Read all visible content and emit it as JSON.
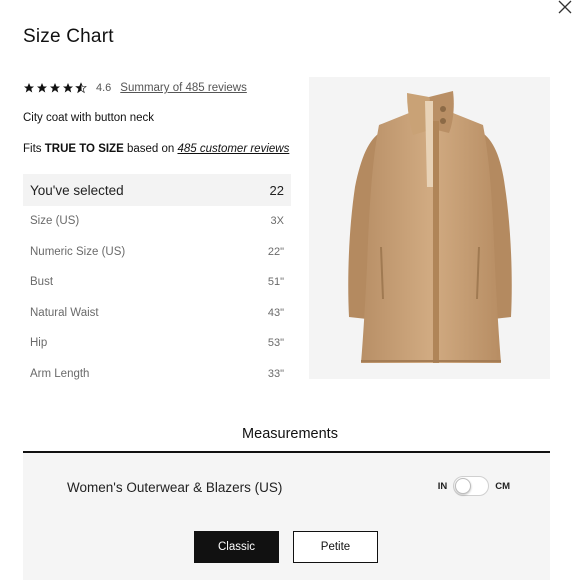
{
  "dialog": {
    "title": "Size Chart",
    "close_icon": "close-icon"
  },
  "rating": {
    "stars": 4.5,
    "value": "4.6",
    "summary_link": "Summary of 485 reviews"
  },
  "product": {
    "name": "City coat with button neck",
    "fit_prefix": "Fits ",
    "fit_bold": "TRUE TO SIZE",
    "fit_middle": " based on ",
    "fit_link": "485 customer reviews",
    "image_color": "#c9a37a"
  },
  "size_table": {
    "selected_label": "You've selected",
    "selected_value": "22",
    "rows": [
      {
        "label": "Size (US)",
        "value": "3X"
      },
      {
        "label": "Numeric Size (US)",
        "value": "22\""
      },
      {
        "label": "Bust",
        "value": "51\""
      },
      {
        "label": "Natural Waist",
        "value": "43\""
      },
      {
        "label": "Hip",
        "value": "53\""
      },
      {
        "label": "Arm Length",
        "value": "33\""
      }
    ]
  },
  "measurements": {
    "title": "Measurements",
    "category": "Women's Outerwear & Blazers (US)",
    "unit_left": "IN",
    "unit_right": "CM",
    "unit_selected": "IN",
    "buttons": [
      {
        "label": "Classic",
        "active": true
      },
      {
        "label": "Petite",
        "active": false
      }
    ]
  }
}
